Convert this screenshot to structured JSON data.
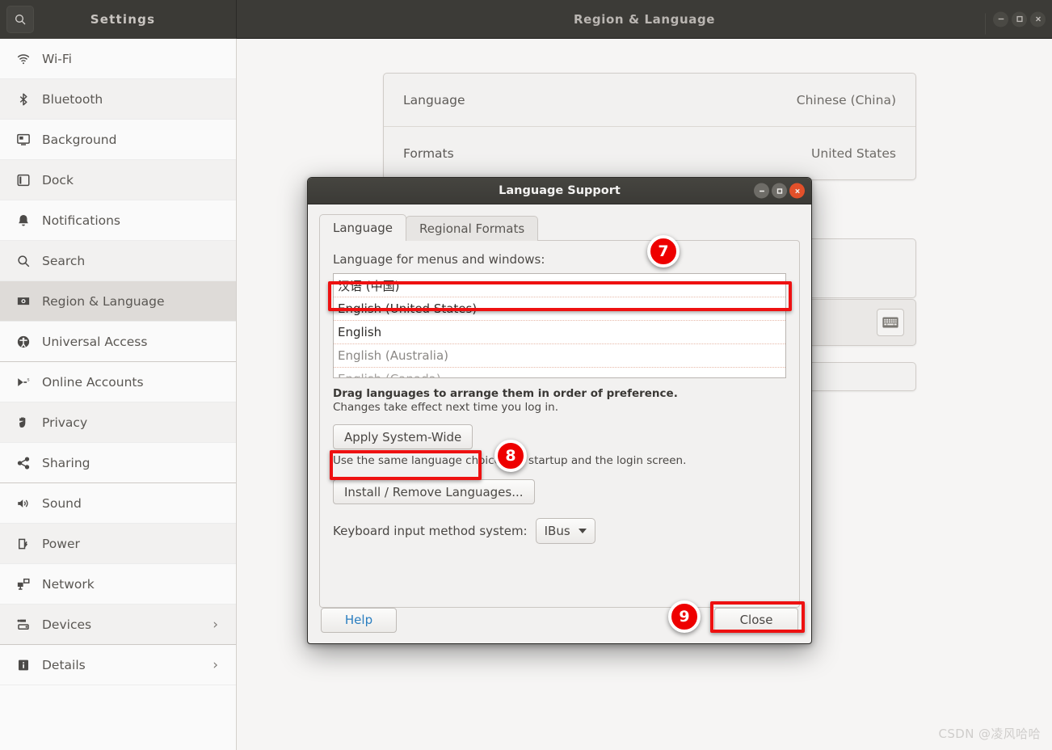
{
  "window": {
    "app_title": "Settings",
    "page_title": "Region & Language",
    "search_icon": "search-icon",
    "controls": [
      {
        "name": "minimize-icon",
        "label": "Minimize"
      },
      {
        "name": "maximize-icon",
        "label": "Maximize"
      },
      {
        "name": "close-icon",
        "label": "Close"
      }
    ]
  },
  "sidebar": {
    "items": [
      {
        "label": "Wi-Fi",
        "icon": "wifi-icon",
        "selected": false,
        "chevron": false
      },
      {
        "label": "Bluetooth",
        "icon": "bluetooth-icon",
        "selected": false,
        "chevron": false
      },
      {
        "label": "Background",
        "icon": "background-icon",
        "selected": false,
        "chevron": false
      },
      {
        "label": "Dock",
        "icon": "dock-icon",
        "selected": false,
        "chevron": false
      },
      {
        "label": "Notifications",
        "icon": "bell-icon",
        "selected": false,
        "chevron": false
      },
      {
        "label": "Search",
        "icon": "search-icon",
        "selected": false,
        "chevron": false
      },
      {
        "label": "Region & Language",
        "icon": "region-language-icon",
        "selected": true,
        "chevron": false
      },
      {
        "label": "Universal Access",
        "icon": "universal-access-icon",
        "selected": false,
        "chevron": false
      },
      {
        "label": "Online Accounts",
        "icon": "online-accounts-icon",
        "selected": false,
        "chevron": false
      },
      {
        "label": "Privacy",
        "icon": "privacy-hand-icon",
        "selected": false,
        "chevron": false
      },
      {
        "label": "Sharing",
        "icon": "sharing-icon",
        "selected": false,
        "chevron": false
      },
      {
        "label": "Sound",
        "icon": "sound-icon",
        "selected": false,
        "chevron": false
      },
      {
        "label": "Power",
        "icon": "power-battery-icon",
        "selected": false,
        "chevron": false
      },
      {
        "label": "Network",
        "icon": "network-icon",
        "selected": false,
        "chevron": false
      },
      {
        "label": "Devices",
        "icon": "devices-icon",
        "selected": false,
        "chevron": true
      },
      {
        "label": "Details",
        "icon": "details-info-icon",
        "selected": false,
        "chevron": true
      }
    ]
  },
  "main": {
    "rows": [
      {
        "key": "Language",
        "value": "Chinese (China)"
      },
      {
        "key": "Formats",
        "value": "United States"
      }
    ],
    "keyboard_button_icon": "keyboard-icon"
  },
  "dialog": {
    "title": "Language Support",
    "controls": [
      {
        "name": "minimize-icon",
        "label": "Minimize"
      },
      {
        "name": "maximize-icon",
        "label": "Maximize"
      },
      {
        "name": "close-icon",
        "label": "Close"
      }
    ],
    "tabs": [
      {
        "label": "Language",
        "active": true
      },
      {
        "label": "Regional Formats",
        "active": false
      }
    ],
    "list_label": "Language for menus and windows:",
    "languages": [
      {
        "label": "汉语 (中国)",
        "state": "selected"
      },
      {
        "label": "English (United States)",
        "state": "normal"
      },
      {
        "label": "English",
        "state": "normal"
      },
      {
        "label": "English (Australia)",
        "state": "dim"
      },
      {
        "label": "English (Canada)",
        "state": "dimmer"
      }
    ],
    "hint_bold": "Drag languages to arrange them in order of preference.",
    "hint_normal": "Changes take effect next time you log in.",
    "apply_button": "Apply System-Wide",
    "apply_note": "Use the same language choices for startup and the login screen.",
    "install_button": "Install / Remove Languages...",
    "keyboard_label": "Keyboard input method system:",
    "keyboard_value": "IBus",
    "help_button": "Help",
    "close_button": "Close"
  },
  "annotations": {
    "badges": [
      {
        "number": "7",
        "target": "language-list-row-selected"
      },
      {
        "number": "8",
        "target": "apply-system-wide-button"
      },
      {
        "number": "9",
        "target": "dialog-close-button"
      }
    ],
    "highlight_color": "#ee1111",
    "badge_color": "#ee0000"
  },
  "watermark": "CSDN @凌风哈哈"
}
